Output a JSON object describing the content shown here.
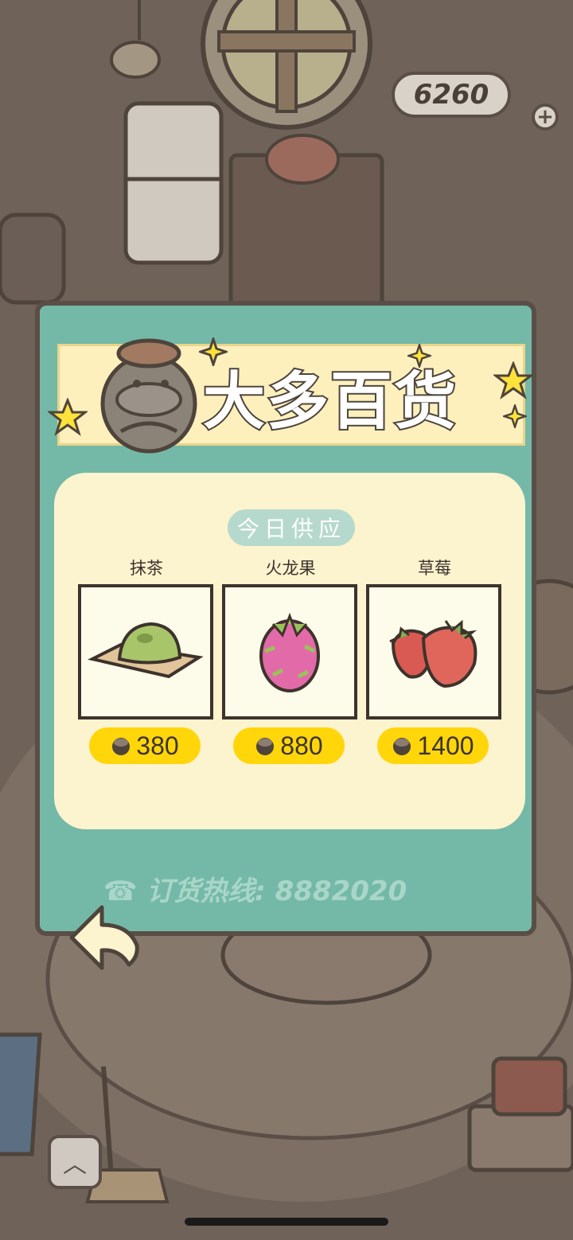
{
  "hud": {
    "currency": "6260",
    "add_label": "+"
  },
  "shop": {
    "title": "大多百货",
    "section_label": "今日供应",
    "items": [
      {
        "name": "抹茶",
        "price": "380"
      },
      {
        "name": "火龙果",
        "price": "880"
      },
      {
        "name": "草莓",
        "price": "1400"
      }
    ],
    "hotline": "订货热线: 8882020"
  },
  "nav": {
    "up_icon": "chevron-up-icon",
    "back_icon": "back-arrow-icon"
  },
  "colors": {
    "panel": "#74b9a7",
    "cream": "#fcf3cf",
    "price_tag": "#ffd60a",
    "outline": "#5a4e46"
  }
}
